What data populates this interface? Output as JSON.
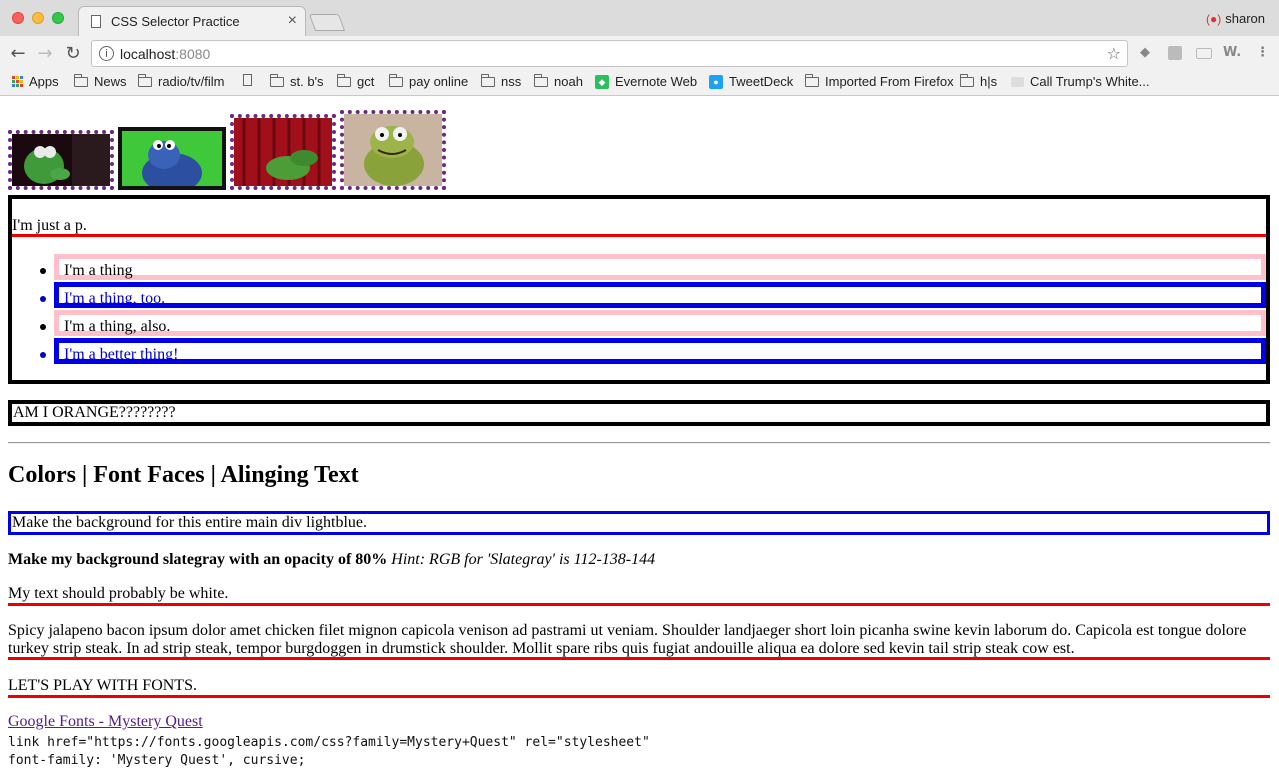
{
  "browser": {
    "tab_title": "CSS Selector Practice",
    "tab_close": "×",
    "profile_name": "sharon",
    "url_host": "localhost",
    "url_port": ":8080",
    "back_icon": "←",
    "forward_icon": "→",
    "reload_icon": "↻",
    "star_icon": "☆",
    "info_icon": "i",
    "extensions": [
      "evernote-icon",
      "extension-icon",
      "extension-icon",
      "w-icon",
      "menu-icon"
    ],
    "bookmarks": [
      {
        "label": "Apps",
        "icon": "apps-grid-icon"
      },
      {
        "label": "News",
        "icon": "folder-icon"
      },
      {
        "label": "radio/tv/film",
        "icon": "folder-icon"
      },
      {
        "label": "",
        "icon": "page-icon"
      },
      {
        "label": "st. b's",
        "icon": "folder-icon"
      },
      {
        "label": "gct",
        "icon": "folder-icon"
      },
      {
        "label": "pay online",
        "icon": "folder-icon"
      },
      {
        "label": "nss",
        "icon": "folder-icon"
      },
      {
        "label": "noah",
        "icon": "folder-icon"
      },
      {
        "label": "Evernote Web",
        "icon": "evernote-icon"
      },
      {
        "label": "TweetDeck",
        "icon": "twitter-icon"
      },
      {
        "label": "Imported From Firefox",
        "icon": "folder-icon"
      },
      {
        "label": "h|s",
        "icon": "folder-icon"
      },
      {
        "label": "Call Trump's White...",
        "icon": "site-icon"
      }
    ]
  },
  "page": {
    "just_p": "I'm just a p.",
    "list_items": [
      "I'm a thing",
      "I'm a thing, too.",
      "I'm a thing, also.",
      "I'm a better thing!"
    ],
    "orange": "AM I ORANGE????????",
    "heading": "Colors | Font Faces | Alinging Text",
    "lightblue": "Make the background for this entire main div lightblue.",
    "slate_bold": "Make my background slategray with an opacity of 80%",
    "slate_hint": "Hint: RGB for 'Slategray' is 112-138-144",
    "white_text": "My text should probably be white.",
    "ipsum": "Spicy jalapeno bacon ipsum dolor amet chicken filet mignon capicola venison ad pastrami ut veniam. Shoulder landjaeger short loin picanha swine kevin laborum do. Capicola est tongue dolore turkey strip steak. In ad strip steak, tempor burgdoggen in drumstick shoulder. Mollit spare ribs quis fugiat andouille aliqua ea dolore sed kevin tail strip steak cow est.",
    "fonts": "LET'S PLAY WITH FONTS.",
    "google_link": "Google Fonts - Mystery Quest",
    "code_line1": "link href=\"https://fonts.googleapis.com/css?family=Mystery+Quest\" rel=\"stylesheet\"",
    "code_line2": "font-family: 'Mystery Quest', cursive;"
  },
  "colors": {
    "list_pink": "#ffc0cb",
    "list_blue": "#0000e6",
    "underline_red": "#e00000",
    "image_border_purple": "#6b2a7b"
  }
}
